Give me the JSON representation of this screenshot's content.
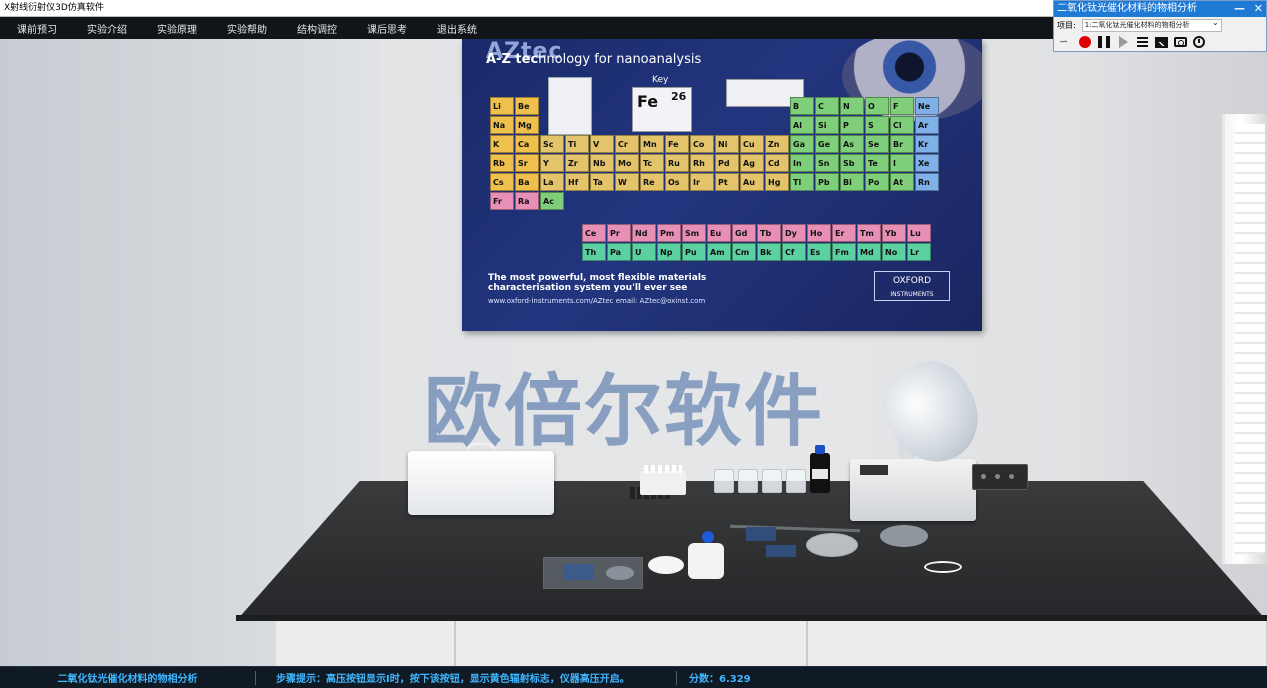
{
  "window": {
    "title": "X射线衍射仪3D仿真软件"
  },
  "menu": {
    "items": [
      "课前预习",
      "实验介绍",
      "实验原理",
      "实验帮助",
      "结构调控",
      "课后思考",
      "退出系统"
    ]
  },
  "panel": {
    "title": "二氧化钛光催化材料的物相分析",
    "minimize": "—",
    "close": "✕",
    "project_label": "项目:",
    "project_value": "1:二氧化钛光催化材料的物相分析",
    "tools": [
      "swirl-icon",
      "record-icon",
      "pause-icon",
      "play-icon",
      "menu-icon",
      "image-icon",
      "camera-icon",
      "clock-icon"
    ]
  },
  "poster": {
    "brand": "AZtec",
    "tagline_bold": "A-Z tec",
    "tagline_rest": "hnology for nanoanalysis",
    "key_title": "Key",
    "fe_symbol": "Fe",
    "fe_number": "26",
    "foot_line1": "The most powerful, most flexible materials",
    "foot_line2": "characterisation system you'll ever see",
    "foot_url": "www.oxford-instruments.com/AZtec   email: AZtec@oxinst.com",
    "oxford": "OXFORD",
    "oxford_sub": "INSTRUMENTS",
    "elements_row1": [
      "Li",
      "Be",
      "B",
      "C",
      "N",
      "O",
      "F",
      "Ne"
    ],
    "elements_row2": [
      "Na",
      "Mg",
      "Al",
      "Si",
      "P",
      "S",
      "Cl",
      "Ar"
    ],
    "elements_row3": [
      "K",
      "Ca",
      "Sc",
      "Ti",
      "V",
      "Cr",
      "Mn",
      "Fe",
      "Co",
      "Ni",
      "Cu",
      "Zn",
      "Ga",
      "Ge",
      "As",
      "Se",
      "Br",
      "Kr"
    ],
    "elements_row4": [
      "Rb",
      "Sr",
      "Y",
      "Zr",
      "Nb",
      "Mo",
      "Tc",
      "Ru",
      "Rh",
      "Pd",
      "Ag",
      "Cd",
      "In",
      "Sn",
      "Sb",
      "Te",
      "I",
      "Xe"
    ],
    "elements_row5": [
      "Cs",
      "Ba",
      "La",
      "Hf",
      "Ta",
      "W",
      "Re",
      "Os",
      "Ir",
      "Pt",
      "Au",
      "Hg",
      "Tl",
      "Pb",
      "Bi",
      "Po",
      "At",
      "Rn"
    ],
    "elements_row6": [
      "Fr",
      "Ra",
      "Ac"
    ],
    "lanthanides": [
      "Ce",
      "Pr",
      "Nd",
      "Pm",
      "Sm",
      "Eu",
      "Gd",
      "Tb",
      "Dy",
      "Ho",
      "Er",
      "Tm",
      "Yb",
      "Lu"
    ],
    "actinides": [
      "Th",
      "Pa",
      "U",
      "Np",
      "Pu",
      "Am",
      "Cm",
      "Bk",
      "Cf",
      "Es",
      "Fm",
      "Md",
      "No",
      "Lr"
    ]
  },
  "watermark": "欧倍尔软件",
  "status": {
    "experiment": "二氧化钛光催化材料的物相分析",
    "step_hint": "步骤提示：高压按钮显示Ⅰ时，按下该按钮，显示黄色辐射标志，仪器高压开启。",
    "score": "分数：6.329"
  },
  "colors": {
    "menubar": "#111418",
    "panel_title": "#1f7ad6",
    "status_text": "#3fb6ff",
    "alkali": "#f0c04c",
    "transition": "#e3c46a",
    "nonmetal": "#7fcf7a",
    "noble": "#7fb0e8",
    "lanth": "#e88fb6",
    "actin": "#5bd0a0"
  }
}
